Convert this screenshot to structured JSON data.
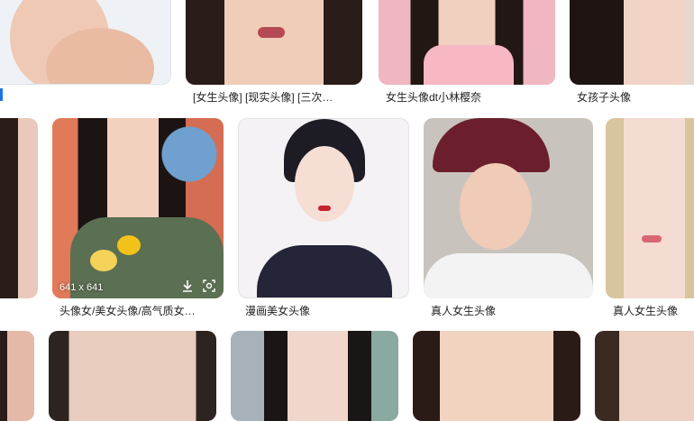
{
  "row1": {
    "captions": [
      "[女生头像] [现实头像] [三次…",
      "女生头像dt小林樱奈",
      "女孩子头像"
    ]
  },
  "row2": {
    "captions": [
      "头像女/美女头像/高气质女…",
      "漫画美女头像",
      "真人女生头像",
      "真人女生头像"
    ],
    "hover_dimensions": "641 x 641"
  },
  "icons": {
    "download": "download-icon",
    "visual_search": "lens-search-icon"
  },
  "colors": {
    "accent_blue": "#1a73e8",
    "card_border": "#e3e3e3"
  }
}
